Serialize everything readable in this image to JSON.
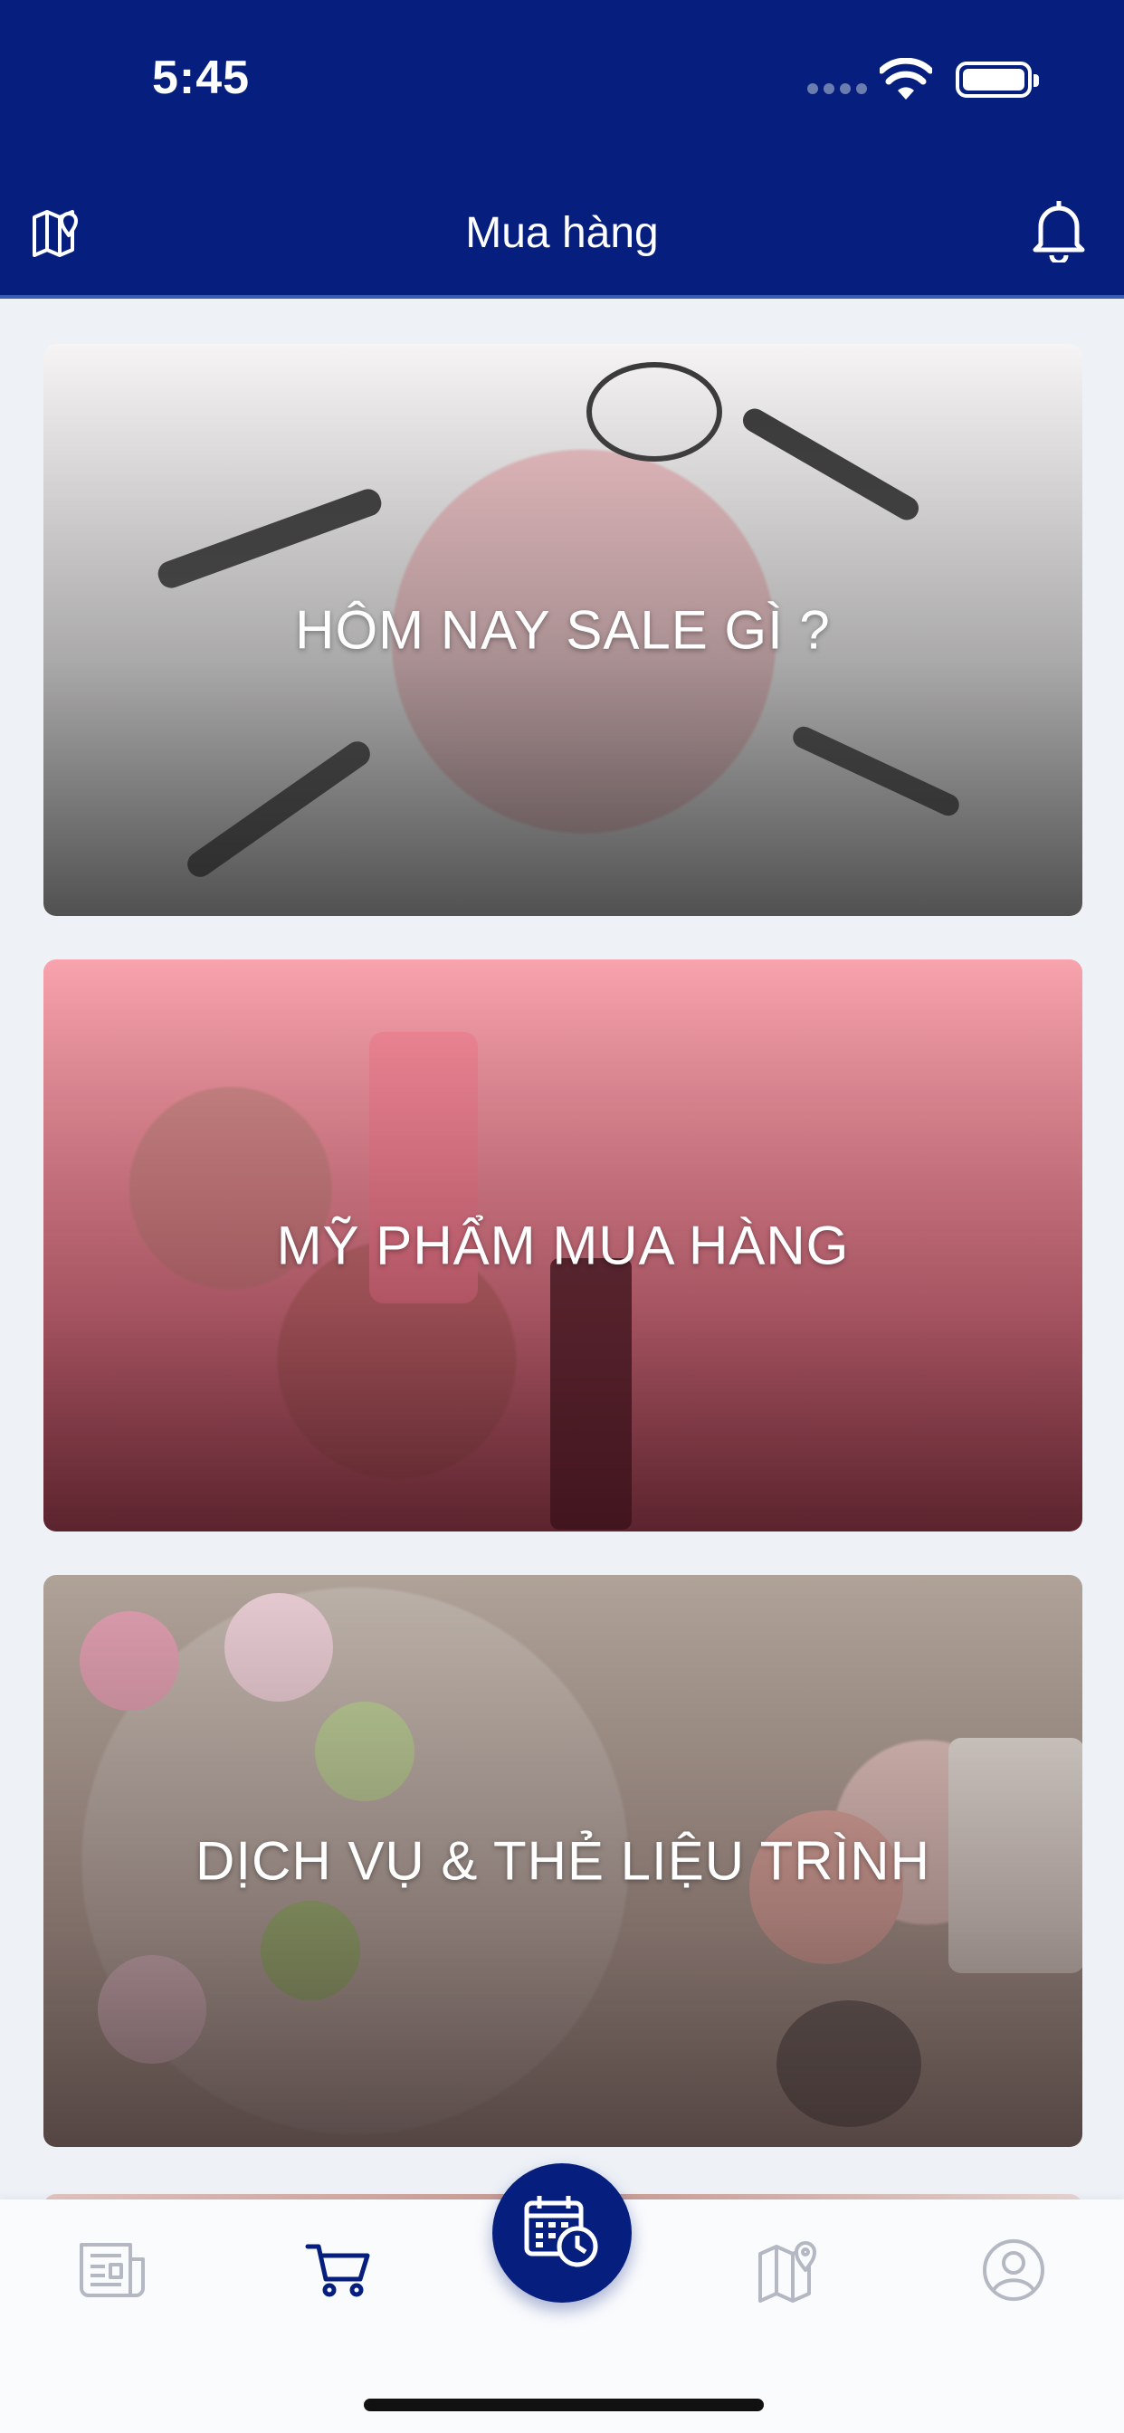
{
  "status_bar": {
    "time": "5:45"
  },
  "header": {
    "title": "Mua hàng"
  },
  "cards": [
    {
      "title": "HÔM NAY SALE GÌ ?"
    },
    {
      "title": "MỸ PHẨM MUA HÀNG"
    },
    {
      "title": "DỊCH VỤ & THẺ LIỆU TRÌNH"
    }
  ],
  "tabbar": {
    "items": [
      "news-icon",
      "cart-icon",
      "calendar-clock-icon",
      "map-pin-icon",
      "user-icon"
    ],
    "active": "cart-icon"
  },
  "colors": {
    "navy": "#061f7e",
    "tab_inactive": "#b3b8c2",
    "tab_active": "#061f7e"
  }
}
